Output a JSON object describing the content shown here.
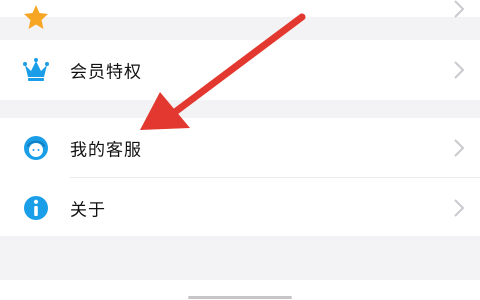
{
  "menu": {
    "items": [
      {
        "label": "会员特权",
        "icon": "crown-icon"
      },
      {
        "label": "我的客服",
        "icon": "customer-service-icon"
      },
      {
        "label": "关于",
        "icon": "info-icon"
      }
    ]
  },
  "annotation": {
    "color": "#e2382f"
  },
  "colors": {
    "accent": "#1a9ee8",
    "chevron": "#c9c9cf"
  }
}
